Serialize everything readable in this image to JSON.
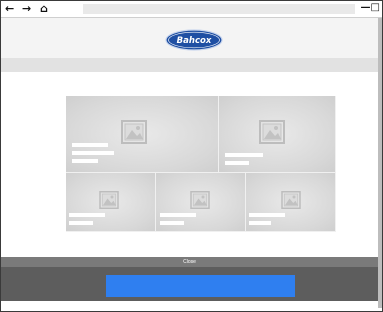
{
  "browser": {
    "back_icon": "←",
    "forward_icon": "→",
    "home_icon": "⌂",
    "window_controls": "—□"
  },
  "header": {
    "logo_text": "Bahcox",
    "logo_color": "#1f4fa3"
  },
  "gallery": {
    "tiles": [
      {
        "name": "tile-1"
      },
      {
        "name": "tile-2"
      },
      {
        "name": "tile-3"
      },
      {
        "name": "tile-4"
      },
      {
        "name": "tile-5"
      }
    ]
  },
  "footer": {
    "close_label": "Close",
    "button_color": "#2f7ff0"
  }
}
